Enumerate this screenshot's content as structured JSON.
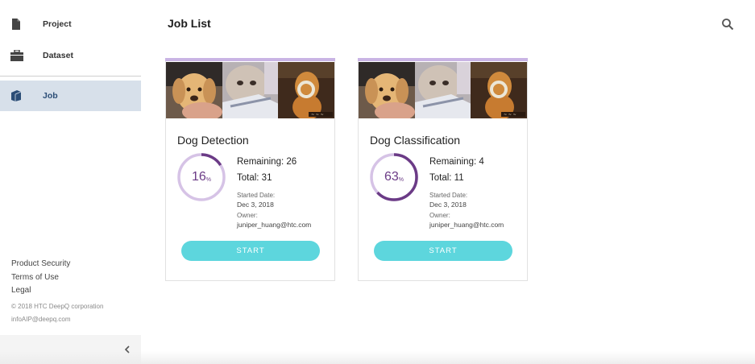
{
  "sidebar": {
    "items": [
      {
        "label": "Project",
        "icon": "file-icon"
      },
      {
        "label": "Dataset",
        "icon": "briefcase-icon"
      },
      {
        "label": "Job",
        "icon": "book-icon"
      }
    ],
    "active_item": "Job",
    "footer": {
      "links": [
        "Product Security",
        "Terms of Use",
        "Legal"
      ],
      "copyright": "© 2018 HTC DeepQ corporation",
      "email": "infoAIP@deepq.com"
    },
    "collapse_icon": "chevron-left-icon"
  },
  "header": {
    "title": "Job List",
    "search_icon": "search-icon"
  },
  "jobs": [
    {
      "title": "Dog Detection",
      "progress": 16,
      "progress_unit": "%",
      "remaining": "Remaining: 26",
      "total": "Total: 31",
      "started_label": "Started Date:",
      "started_value": "Dec 3, 2018",
      "owner_label": "Owner:",
      "owner_value": "juniper_huang@htc.com",
      "start_label": "START"
    },
    {
      "title": "Dog Classification",
      "progress": 63,
      "progress_unit": "%",
      "remaining": "Remaining: 4",
      "total": "Total: 11",
      "started_label": "Started Date:",
      "started_value": "Dec 3, 2018",
      "owner_label": "Owner:",
      "owner_value": "juniper_huang@htc.com",
      "start_label": "START"
    }
  ],
  "colors": {
    "accent": "#5dd6dd",
    "progress_fill": "#6b3b86",
    "progress_track": "#d6c3e6",
    "active_nav": "#d7e0ea",
    "card_topline": "#c9b4e4"
  }
}
